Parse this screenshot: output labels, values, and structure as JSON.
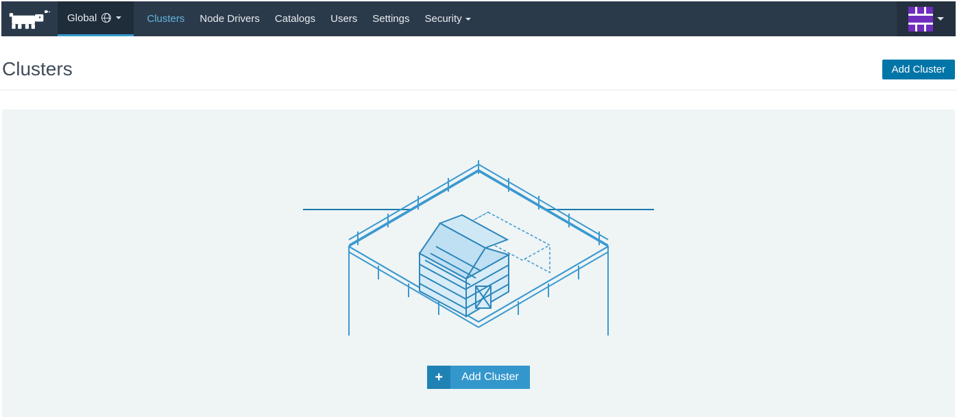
{
  "nav": {
    "scope_label": "Global",
    "items": [
      {
        "label": "Clusters",
        "active": true
      },
      {
        "label": "Node Drivers",
        "active": false
      },
      {
        "label": "Catalogs",
        "active": false
      },
      {
        "label": "Users",
        "active": false
      },
      {
        "label": "Settings",
        "active": false
      },
      {
        "label": "Security",
        "active": false,
        "has_dropdown": true
      }
    ]
  },
  "page": {
    "title": "Clusters",
    "add_cluster_label": "Add Cluster"
  },
  "empty_state": {
    "add_cluster_label": "Add Cluster"
  },
  "colors": {
    "topbar": "#2b3a4b",
    "topbar_dark": "#1f2c3a",
    "accent": "#3399cc",
    "primary_btn": "#0075a8",
    "empty_bg": "#eff4f5",
    "illustration": "#3a99d0",
    "avatar_accent": "#6f2dbd"
  }
}
